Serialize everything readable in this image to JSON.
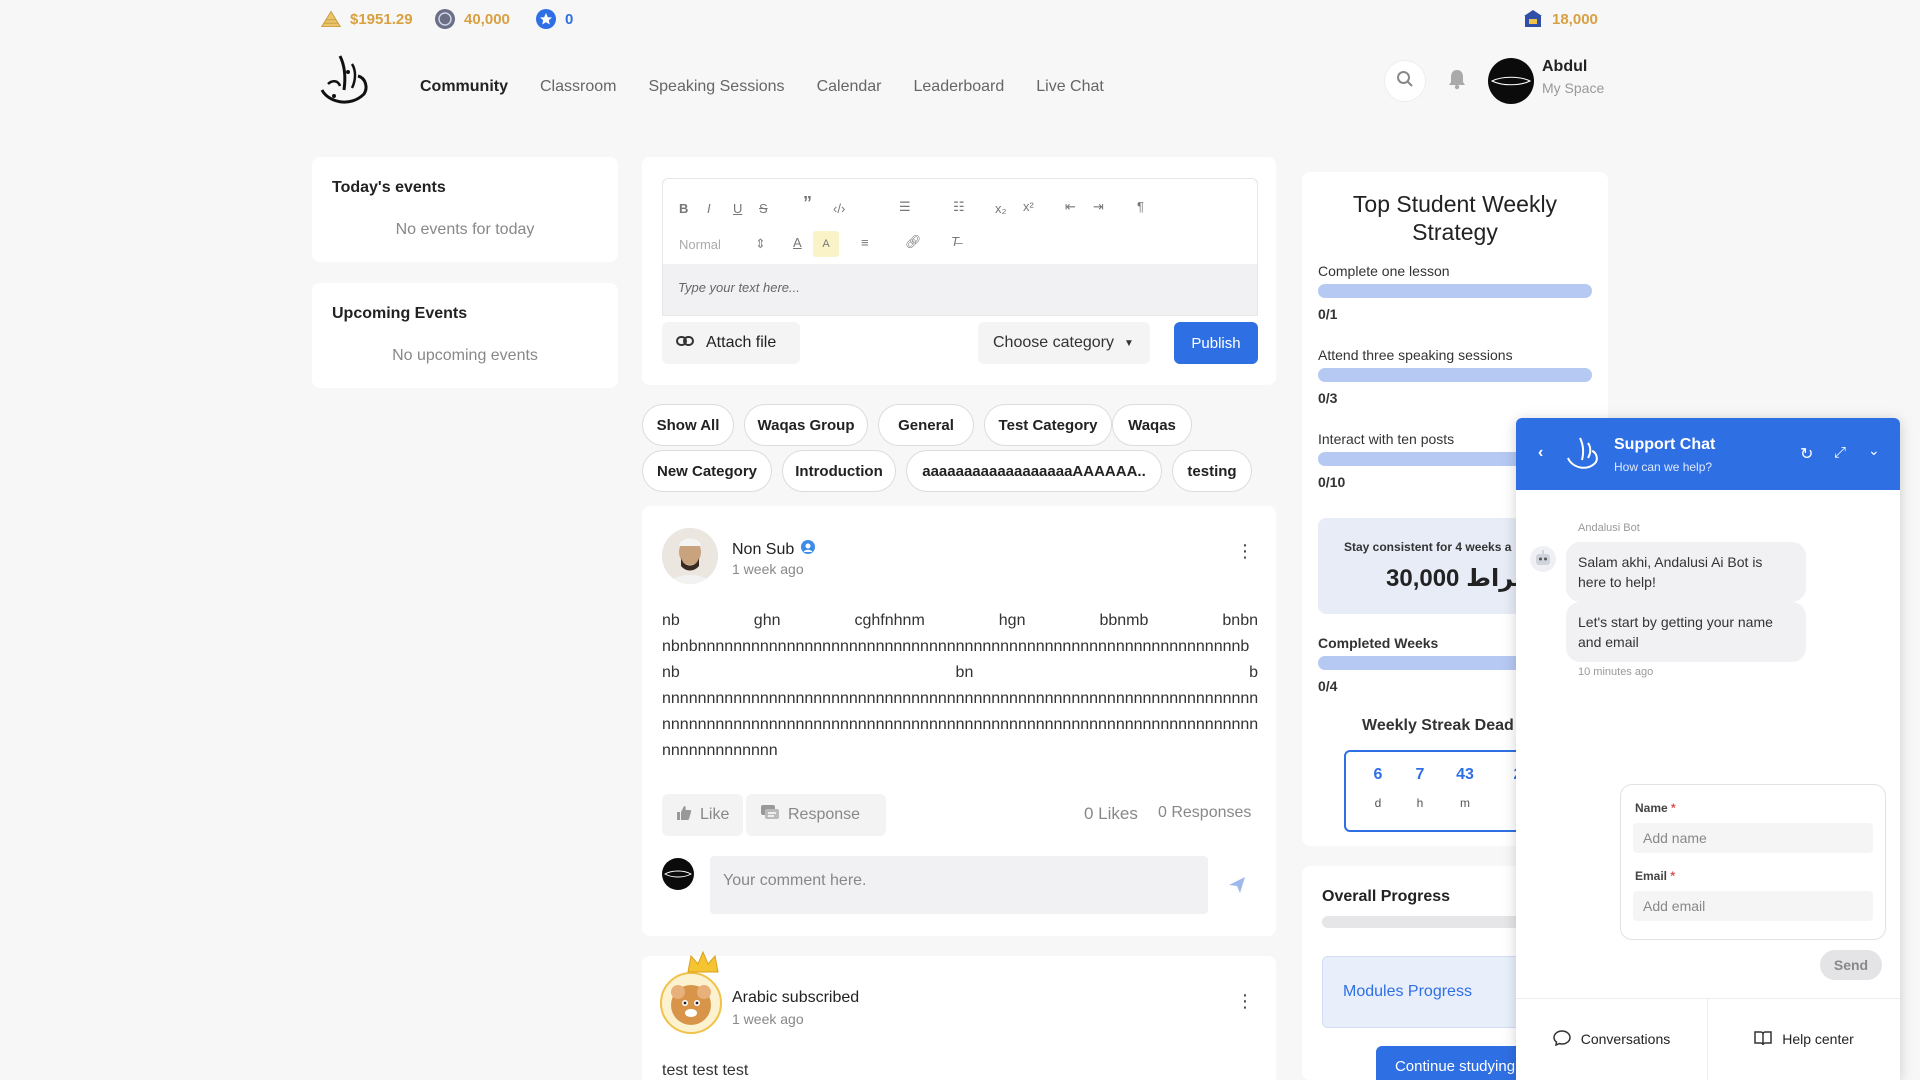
{
  "top_stats": {
    "money": "$1951.29",
    "coins": "40,000",
    "stars": "0",
    "bank": "18,000"
  },
  "nav": {
    "items": [
      "Community",
      "Classroom",
      "Speaking Sessions",
      "Calendar",
      "Leaderboard",
      "Live Chat"
    ]
  },
  "user": {
    "name": "Abdul",
    "subtitle": "My Space"
  },
  "left": {
    "today_title": "Today's events",
    "today_empty": "No events for today",
    "upcoming_title": "Upcoming Events",
    "upcoming_empty": "No upcoming events"
  },
  "editor": {
    "style_select": "Normal",
    "placeholder": "Type your text here...",
    "attach_label": "Attach file",
    "category_label": "Choose category",
    "publish_label": "Publish"
  },
  "categories": [
    "Show All",
    "Waqas Group",
    "General",
    "Test Category",
    "Waqas",
    "New Category",
    "Introduction",
    "aaaaaaaaaaaaaaaaaaAAAAAA..",
    "testing"
  ],
  "post1": {
    "author": "Non Sub",
    "time": "1 week ago",
    "row1": [
      "nb",
      "ghn",
      "cghfnhnm",
      "hgn",
      "bbnmb",
      "bnbn"
    ],
    "line2": "nbnbnnnnnnnnnnnnnnnnnnnnnnnnnnnnnnnnnnnnnnnnnnnnnnnnnnnnnnnnnnnnnb",
    "row3": [
      "nb",
      "bn",
      "b"
    ],
    "line4": "nnnnnnnnnnnnnnnnnnnnnnnnnnnnnnnnnnnnnnnnnnnnnnnnnnnnnnnnnnnnnnnnnnnn",
    "line5": "nnnnnnnnnnnnnnnnnnnnnnnnnnnnnnnnnnnnnnnnnnnnnnnnnnnnnnnnnnnnnnnnnnnn",
    "line6": "nnnnnnnnnnnnn",
    "like_label": "Like",
    "response_label": "Response",
    "likes": "0 Likes",
    "responses": "0 Responses",
    "comment_placeholder": "Your comment here."
  },
  "post2": {
    "author": "Arabic subscribed",
    "time": "1 week ago",
    "body": "test test test"
  },
  "strategy": {
    "title_line1": "Top Student Weekly",
    "title_line2": "Strategy",
    "tasks": [
      {
        "label": "Complete one lesson",
        "count": "0/1",
        "progress": 0
      },
      {
        "label": "Attend three speaking sessions",
        "count": "0/3",
        "progress": 0
      },
      {
        "label": "Interact with ten posts",
        "count": "0/10",
        "progress": 0
      }
    ],
    "reward_title": "Stay consistent for 4 weeks a",
    "reward_value": "30,000 قيراط",
    "completed_label": "Completed Weeks",
    "completed_count": "0/4",
    "streak_title": "Weekly Streak Dead",
    "countdown": [
      {
        "value": "6",
        "unit": "d"
      },
      {
        "value": "7",
        "unit": "h"
      },
      {
        "value": "43",
        "unit": "m"
      },
      {
        "value": "2",
        "unit": ""
      }
    ],
    "overall_title": "Overall Progress",
    "modules_label": "Modules Progress",
    "continue_label": "Continue studying"
  },
  "chat": {
    "title": "Support Chat",
    "subtitle": "How can we help?",
    "bot_name": "Andalusi Bot",
    "msg1": "Salam akhi, Andalusi Ai Bot is here to help!",
    "msg2": "Let's start by getting your name and email",
    "msg_time": "10 minutes ago",
    "name_label": "Name",
    "name_placeholder": "Add name",
    "email_label": "Email",
    "email_placeholder": "Add email",
    "send_label": "Send",
    "conversations_label": "Conversations",
    "help_label": "Help center"
  },
  "colors": {
    "brand_blue": "#2f6fe4",
    "gold": "#d9a040",
    "progress_track": "#b6c9f3"
  }
}
